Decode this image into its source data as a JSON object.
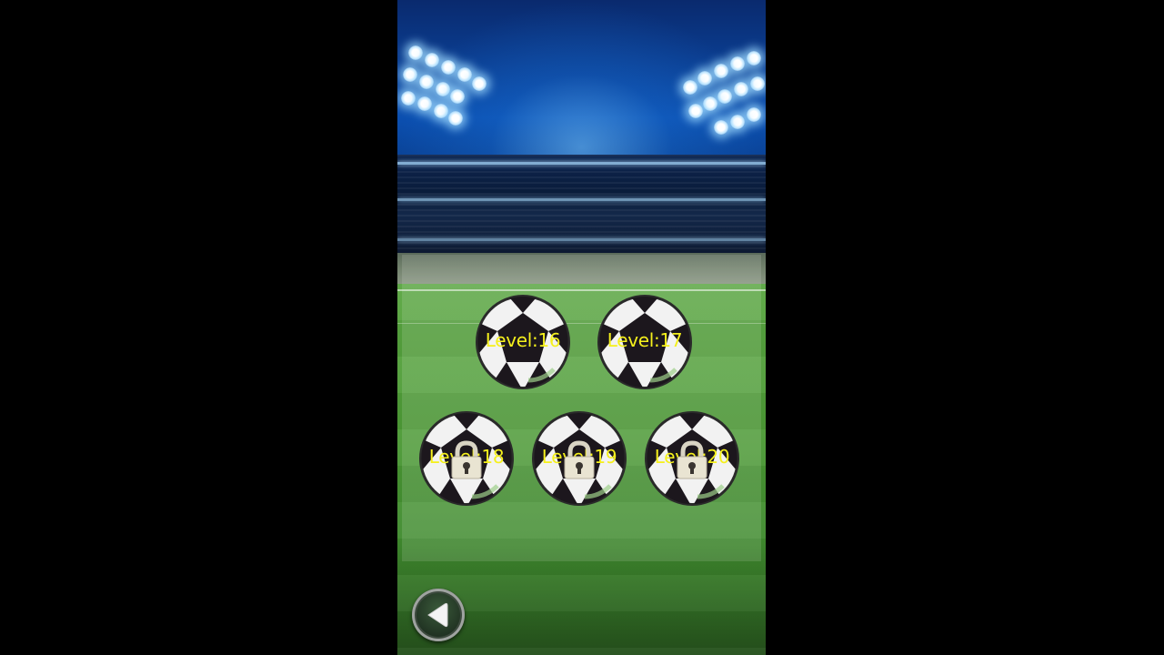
{
  "levels": {
    "row1": [
      {
        "label": "Level:16",
        "locked": false
      },
      {
        "label": "Level:17",
        "locked": false
      }
    ],
    "row2": [
      {
        "label": "Level:18",
        "locked": true
      },
      {
        "label": "Level:19",
        "locked": true
      },
      {
        "label": "Level:20",
        "locked": true
      }
    ]
  },
  "icons": {
    "back": "back-arrow-icon",
    "lock": "padlock-icon",
    "ball": "soccer-ball-icon"
  },
  "colors": {
    "label": "#f5f01c",
    "pitch": "#4c9a33",
    "sky": "#0b4fb0"
  }
}
